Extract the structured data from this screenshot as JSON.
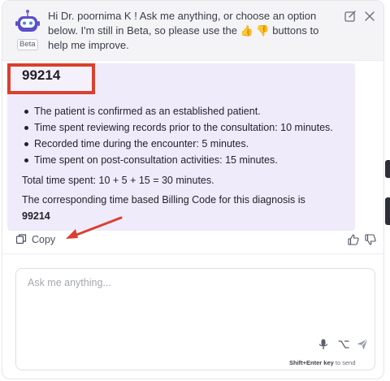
{
  "header": {
    "greeting": "Hi Dr. poornima K ! Ask me anything, or choose an option below. I'm still in Beta, so please use the 👍 👎 buttons to help me improve.",
    "beta_label": "Beta",
    "icons": [
      "bot-avatar-icon",
      "edit-icon",
      "close-icon"
    ]
  },
  "answer": {
    "code_title": "99214",
    "bullets": [
      "The patient is confirmed as an established patient.",
      "Time spent reviewing records prior to the consultation: 10 minutes.",
      "Recorded time during the encounter: 5 minutes.",
      "Time spent on post-consultation activities: 15 minutes."
    ],
    "total": "Total time spent: 10 + 5 + 15 = 30 minutes.",
    "billing_text": "The corresponding time based Billing Code for this diagnosis is",
    "billing_code": "99214"
  },
  "actions": {
    "copy_label": "Copy",
    "icons": [
      "copy-icon",
      "thumbs-up-icon",
      "thumbs-down-icon"
    ]
  },
  "composer": {
    "placeholder": "Ask me anything...",
    "hint_keys": "Shift+Enter key",
    "hint_text": "to send",
    "icons": [
      "mic-icon",
      "shortcut-icon",
      "send-icon"
    ]
  },
  "colors": {
    "highlight_border": "#d9402f",
    "answer_bg": "#efebfb",
    "arrow": "#d9402f",
    "header_bg": "#f4f4f7"
  }
}
